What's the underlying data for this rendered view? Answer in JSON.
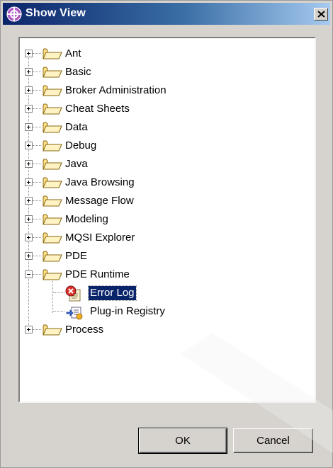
{
  "dialog": {
    "title": "Show View",
    "close_glyph": "✕"
  },
  "tree": {
    "items": [
      {
        "label": "Ant",
        "icon": "folder-icon",
        "expanded": false
      },
      {
        "label": "Basic",
        "icon": "folder-icon",
        "expanded": false
      },
      {
        "label": "Broker Administration",
        "icon": "folder-icon",
        "expanded": false
      },
      {
        "label": "Cheat Sheets",
        "icon": "folder-icon",
        "expanded": false
      },
      {
        "label": "Data",
        "icon": "folder-icon",
        "expanded": false
      },
      {
        "label": "Debug",
        "icon": "folder-icon",
        "expanded": false
      },
      {
        "label": "Java",
        "icon": "folder-icon",
        "expanded": false
      },
      {
        "label": "Java Browsing",
        "icon": "folder-icon",
        "expanded": false
      },
      {
        "label": "Message Flow",
        "icon": "folder-icon",
        "expanded": false
      },
      {
        "label": "Modeling",
        "icon": "folder-icon",
        "expanded": false
      },
      {
        "label": "MQSI Explorer",
        "icon": "folder-icon",
        "expanded": false
      },
      {
        "label": "PDE",
        "icon": "folder-icon",
        "expanded": false
      },
      {
        "label": "PDE Runtime",
        "icon": "folder-icon",
        "expanded": true,
        "children": [
          {
            "label": "Error Log",
            "icon": "error-log-icon",
            "selected": true
          },
          {
            "label": "Plug-in Registry",
            "icon": "plugin-registry-icon",
            "selected": false
          }
        ]
      },
      {
        "label": "Process",
        "icon": "folder-icon",
        "expanded": false
      }
    ]
  },
  "buttons": {
    "ok": "OK",
    "cancel": "Cancel"
  },
  "colors": {
    "title_gradient_start": "#0a246a",
    "title_gradient_end": "#a6caf0",
    "dialog_bg": "#d6d3ce",
    "selection_bg": "#0a246a",
    "folder_fill": "#ffd966"
  }
}
